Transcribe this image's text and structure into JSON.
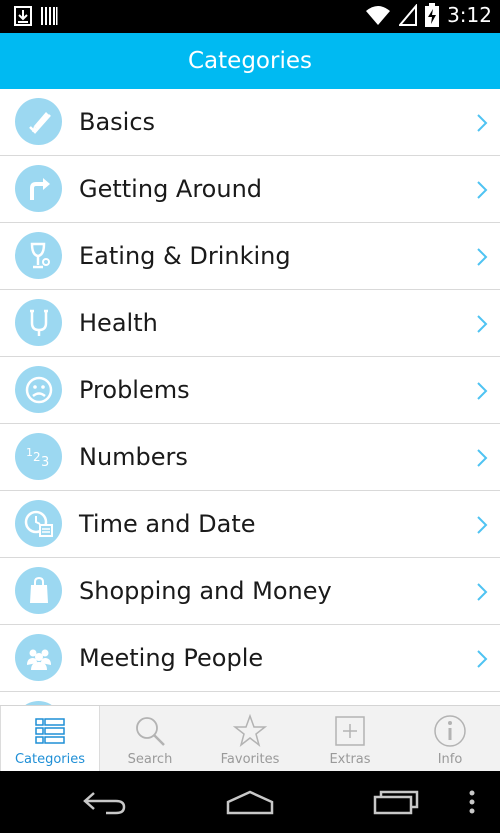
{
  "status_bar": {
    "time": "3:12",
    "left_icons": [
      "download-icon",
      "barcode-icon"
    ],
    "right_icons": [
      "wifi-icon",
      "signal-icon",
      "battery-icon"
    ]
  },
  "header": {
    "title": "Categories"
  },
  "categories": [
    {
      "label": "Basics",
      "icon": "pencil-checkmark-icon"
    },
    {
      "label": "Getting Around",
      "icon": "turn-right-arrow-icon"
    },
    {
      "label": "Eating & Drinking",
      "icon": "wine-glass-icon"
    },
    {
      "label": "Health",
      "icon": "stethoscope-icon"
    },
    {
      "label": "Problems",
      "icon": "sad-face-icon"
    },
    {
      "label": "Numbers",
      "icon": "numbers-123-icon"
    },
    {
      "label": "Time and Date",
      "icon": "clock-calendar-icon"
    },
    {
      "label": "Shopping and Money",
      "icon": "shopping-bag-icon"
    },
    {
      "label": "Meeting People",
      "icon": "people-group-icon"
    }
  ],
  "tab_bar": {
    "tabs": [
      {
        "label": "Categories",
        "icon": "list-icon",
        "active": true
      },
      {
        "label": "Search",
        "icon": "search-icon",
        "active": false
      },
      {
        "label": "Favorites",
        "icon": "star-icon",
        "active": false
      },
      {
        "label": "Extras",
        "icon": "plus-box-icon",
        "active": false
      },
      {
        "label": "Info",
        "icon": "info-icon",
        "active": false
      }
    ]
  },
  "nav_bar": {
    "buttons": [
      "back-icon",
      "home-icon",
      "recent-apps-icon",
      "overflow-menu-icon"
    ]
  },
  "colors": {
    "header_bg": "#00baf2",
    "icon_circle": "#9cd8f1",
    "chevron": "#4fc3f2",
    "active_tab_label": "#1f8fd6",
    "inactive_tab": "#9a9a9a"
  }
}
